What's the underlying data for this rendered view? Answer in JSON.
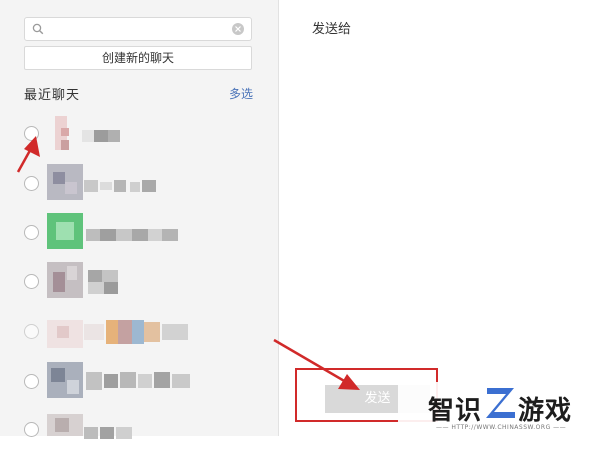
{
  "search": {
    "placeholder": "",
    "value": "",
    "icon": "search-icon",
    "clear_icon": "clear-icon"
  },
  "left": {
    "new_chat_label": "创建新的聊天",
    "recent_title": "最近聊天",
    "multi_select_label": "多选"
  },
  "contacts": [
    {
      "name": "",
      "avatar_color": "#e9c8c8",
      "selected": false
    },
    {
      "name": "",
      "avatar_color": "#a9a9b6",
      "selected": false
    },
    {
      "name": "",
      "avatar_color": "#4cb86a",
      "selected": false
    },
    {
      "name": "",
      "avatar_color": "#b3a9ad",
      "selected": false
    },
    {
      "name": "",
      "avatar_color": "#e8d8d8",
      "selected": false
    },
    {
      "name": "",
      "avatar_color": "#9da3b0",
      "selected": false
    },
    {
      "name": "",
      "avatar_color": "#cfc8c8",
      "selected": false
    }
  ],
  "right": {
    "send_to_label": "发送给",
    "send_button_label": "发送"
  },
  "annotations": {
    "arrow_color": "#d12a2a"
  },
  "watermark": {
    "brand_text": "智识游戏",
    "brand_logo_letter": "Z",
    "url": "—— HTTP://WWW.CHINASSW.ORG ——"
  }
}
